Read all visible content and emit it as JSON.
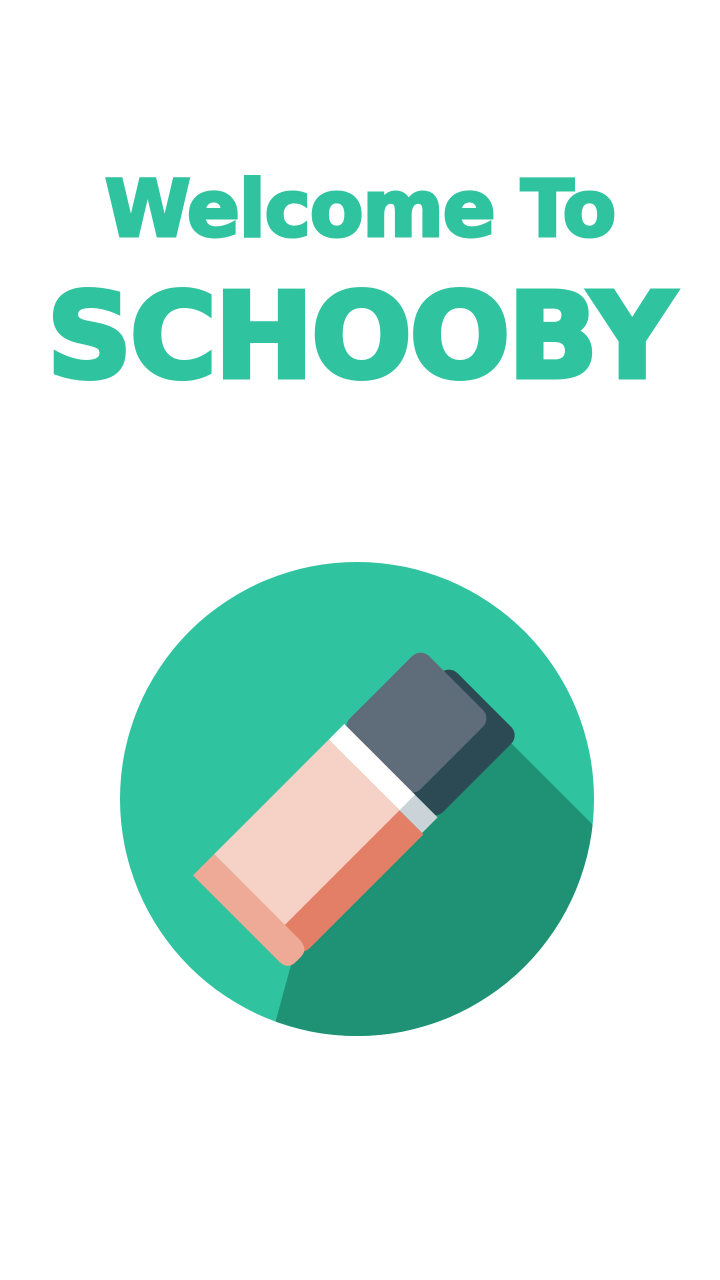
{
  "splash": {
    "welcome_text": "Welcome To",
    "app_name": "SCHOOBY",
    "logo_icon": "eraser-icon"
  },
  "colors": {
    "brand_green": "#2fc39f",
    "shadow_green": "#1f9174",
    "background": "#ffffff",
    "eraser_pink": "#f6d1c6",
    "eraser_side": "#eeaa97",
    "eraser_edge": "#e47f67",
    "eraser_cap": "#5f6d7a",
    "eraser_cap_dark": "#2c4a54",
    "eraser_band": "#ffffff"
  }
}
